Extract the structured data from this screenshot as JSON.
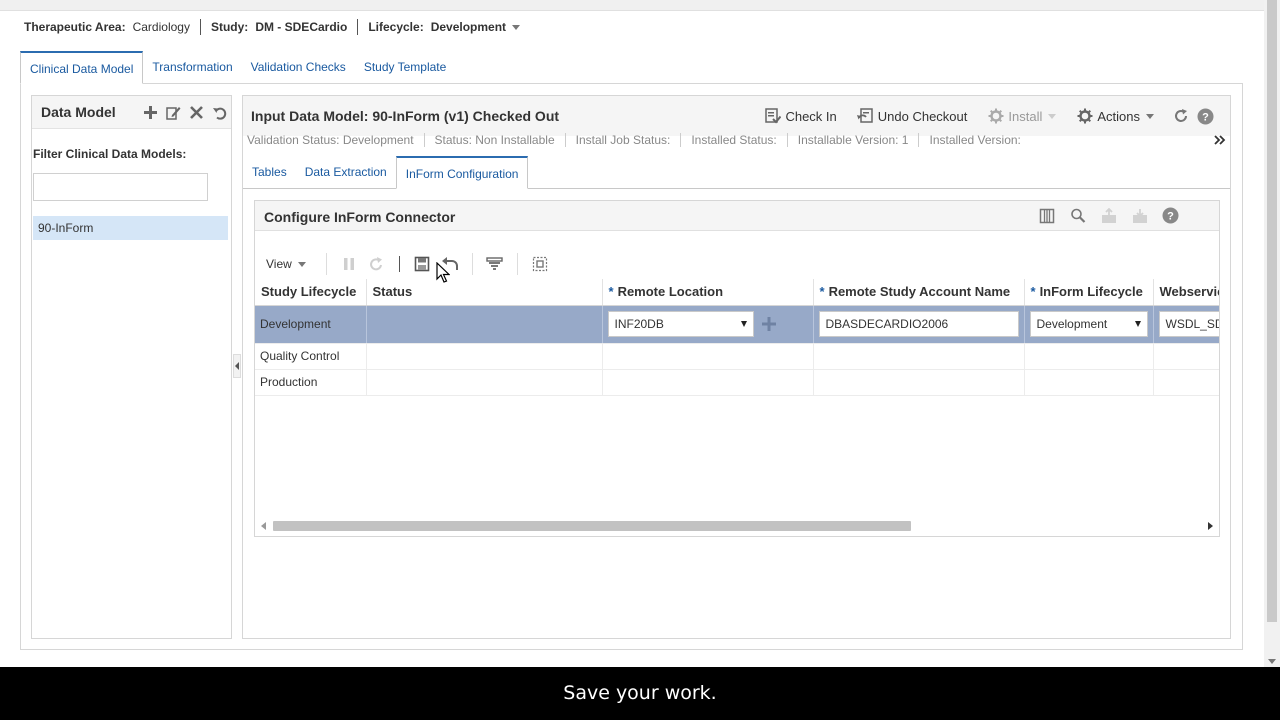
{
  "context": {
    "therapeutic_area_label": "Therapeutic Area:",
    "therapeutic_area_value": "Cardiology",
    "study_label": "Study:",
    "study_value": "DM - SDECardio",
    "lifecycle_label": "Lifecycle:",
    "lifecycle_value": "Development"
  },
  "main_tabs": [
    {
      "label": "Clinical Data Model",
      "active": true
    },
    {
      "label": "Transformation"
    },
    {
      "label": "Validation Checks"
    },
    {
      "label": "Study Template"
    }
  ],
  "left_panel": {
    "title": "Data Model",
    "filter_label": "Filter Clinical Data Models:",
    "filter_value": "",
    "items": [
      "90-InForm"
    ]
  },
  "right_panel": {
    "title": "Input Data Model: 90-InForm (v1) Checked Out",
    "actions": {
      "check_in": "Check In",
      "undo_checkout": "Undo Checkout",
      "install": "Install",
      "actions": "Actions"
    },
    "status": {
      "validation": "Validation Status: Development",
      "status": "Status: Non Installable",
      "install_job": "Install Job Status:",
      "installed": "Installed Status:",
      "installable_version": "Installable Version: 1",
      "installed_version": "Installed Version:"
    },
    "sub_tabs": [
      {
        "label": "Tables"
      },
      {
        "label": "Data Extraction"
      },
      {
        "label": "InForm Configuration",
        "active": true
      }
    ]
  },
  "connector": {
    "title": "Configure InForm Connector",
    "view_label": "View",
    "required_marker": "*",
    "columns": [
      "Study Lifecycle",
      "Status",
      "Remote Location",
      "Remote Study Account Name",
      "InForm Lifecycle",
      "Webservice"
    ],
    "rows": [
      {
        "lifecycle": "Development",
        "status": "",
        "remote_location": "INF20DB",
        "account_name": "DBASDECARDIO2006",
        "inform_lifecycle": "Development",
        "webservice": "WSDL_SD"
      },
      {
        "lifecycle": "Quality Control",
        "status": "",
        "remote_location": "",
        "account_name": "",
        "inform_lifecycle": "",
        "webservice": ""
      },
      {
        "lifecycle": "Production",
        "status": "",
        "remote_location": "",
        "account_name": "",
        "inform_lifecycle": "",
        "webservice": ""
      }
    ]
  },
  "caption": "Save your work.",
  "colors": {
    "link_blue": "#1a5aa0",
    "selected_row": "#97a9c8",
    "list_selected": "#d5e6f7"
  }
}
